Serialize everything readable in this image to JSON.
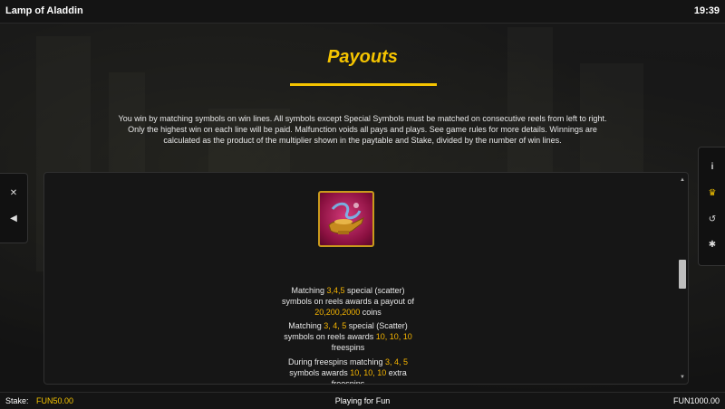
{
  "window": {
    "title": "Lamp of Aladdin",
    "clock": "19:39"
  },
  "page": {
    "heading": "Payouts"
  },
  "intro": {
    "line1": "You win by matching symbols on win lines. All symbols except Special Symbols must be matched on consecutive reels from left to right.",
    "line2": "Only the highest win on each line will be paid. Malfunction voids all pays and plays. See game rules for more details. Winnings are",
    "line3": "calculated as the product of the multiplier shown in the paytable and Stake, divided by the number of win lines."
  },
  "left_menu": {
    "items": [
      {
        "icon": "close-icon",
        "glyph": "✕"
      },
      {
        "icon": "sound-icon",
        "glyph": "◀"
      }
    ]
  },
  "right_menu": {
    "items": [
      {
        "icon": "info-icon",
        "glyph": "i"
      },
      {
        "icon": "trophy-icon",
        "glyph": "♛"
      },
      {
        "icon": "history-icon",
        "glyph": "↺"
      },
      {
        "icon": "settings-gear-icon",
        "glyph": "✱"
      }
    ],
    "active_index": 1
  },
  "paytable": {
    "symbol_icon": "magic-lamp-icon",
    "p1": {
      "a": "Matching ",
      "b": "3,4,5",
      "c": " special (scatter) symbols on reels awards a payout of ",
      "d": "20,200,2000",
      "e": " coins"
    },
    "p2": {
      "a": "Matching ",
      "b": "3, 4, 5",
      "c": " special (Scatter) symbols on reels awards ",
      "d": "10, 10, 10",
      "e": " freespins"
    },
    "p3": {
      "a": "During freespins matching ",
      "b": "3, 4, 5",
      "c": " symbols awards ",
      "d": "10, 10, 10",
      "e": " extra freespins"
    }
  },
  "footer": {
    "stake_label": "Stake:",
    "stake_value": "FUN50.00",
    "mode": "Playing for Fun",
    "balance": "FUN1000.00"
  },
  "colors": {
    "accent": "#f5c400",
    "highlight": "#f5b400",
    "symbol_frame": "#c99a1c"
  }
}
